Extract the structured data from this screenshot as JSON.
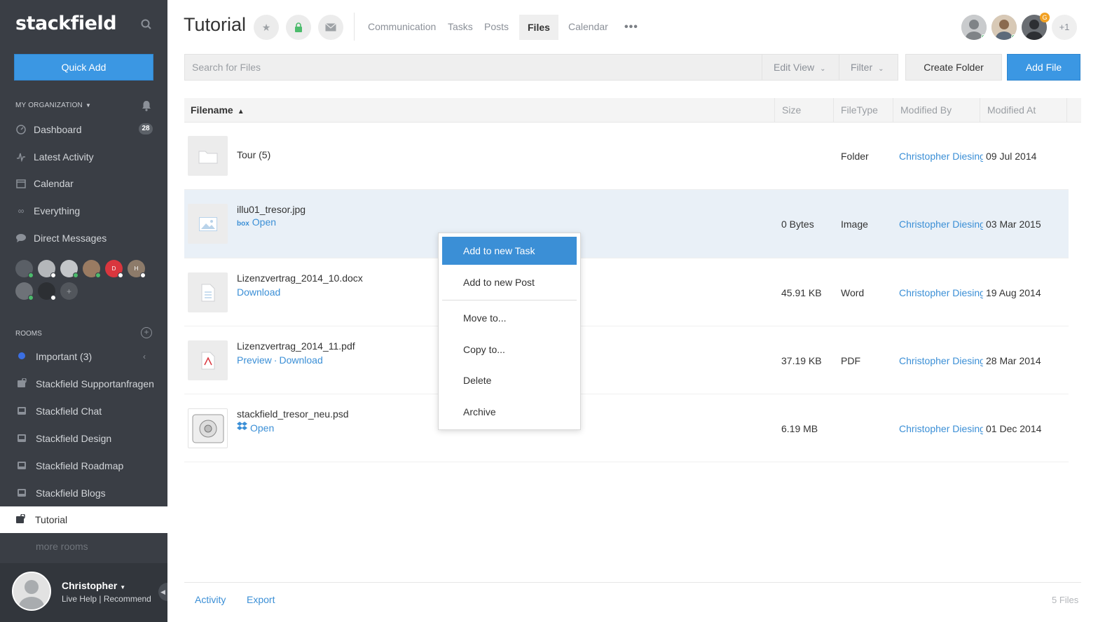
{
  "sidebar": {
    "logo": "stackfield",
    "quick_add": "Quick Add",
    "org_label": "MY ORGANIZATION",
    "nav": [
      {
        "label": "Dashboard",
        "icon": "dashboard-icon",
        "badge": "28"
      },
      {
        "label": "Latest Activity",
        "icon": "activity-icon"
      },
      {
        "label": "Calendar",
        "icon": "calendar-icon"
      },
      {
        "label": "Everything",
        "icon": "infinity-icon"
      },
      {
        "label": "Direct Messages",
        "icon": "chat-bubble-icon"
      }
    ],
    "member_avatars": [
      {
        "initial": "",
        "status": "online"
      },
      {
        "initial": "",
        "status": "offline"
      },
      {
        "initial": "",
        "status": "online"
      },
      {
        "initial": "",
        "status": "online"
      },
      {
        "initial": "D",
        "status": "offline",
        "color": "#d9363e"
      },
      {
        "initial": "H",
        "status": "offline",
        "color": "#8d7b6a"
      },
      {
        "initial": "",
        "status": "online"
      },
      {
        "initial": "",
        "status": "offline"
      },
      {
        "initial": "+",
        "status": ""
      }
    ],
    "rooms_label": "ROOMS",
    "rooms": [
      {
        "label": "Important (3)",
        "icon": "blue-dot-icon"
      },
      {
        "label": "Stackfield Supportanfragen",
        "icon": "room-lock-icon"
      },
      {
        "label": "Stackfield Chat",
        "icon": "room-icon"
      },
      {
        "label": "Stackfield Design",
        "icon": "room-icon"
      },
      {
        "label": "Stackfield Roadmap",
        "icon": "room-icon"
      },
      {
        "label": "Stackfield Blogs",
        "icon": "room-icon"
      }
    ],
    "active_room": "Tutorial",
    "more_rooms": "more rooms",
    "profile": {
      "name": "Christopher",
      "links": "Live Help | Recommend"
    }
  },
  "header": {
    "title": "Tutorial",
    "tabs": [
      "Communication",
      "Tasks",
      "Posts",
      "Files",
      "Calendar"
    ],
    "active_tab": "Files",
    "extra_members": "+1",
    "member_badge": "G"
  },
  "toolbar": {
    "search_placeholder": "Search for Files",
    "edit_view": "Edit View",
    "filter": "Filter",
    "create_folder": "Create Folder",
    "add_file": "Add File"
  },
  "table": {
    "columns": [
      "Filename",
      "Size",
      "FileType",
      "Modified By",
      "Modified At"
    ],
    "rows": [
      {
        "name": "Tour (5)",
        "links": [],
        "size": "",
        "type": "Folder",
        "by": "Christopher Diesing",
        "at": "09 Jul 2014",
        "thumb": "folder-icon"
      },
      {
        "name": "illu01_tresor.jpg",
        "links": [
          "Open"
        ],
        "size": "0 Bytes",
        "type": "Image",
        "by": "Christopher Diesing",
        "at": "03 Mar 2015",
        "thumb": "image-icon",
        "source": "box"
      },
      {
        "name": "Lizenzvertrag_2014_10.docx",
        "links": [
          "Download"
        ],
        "size": "45.91 KB",
        "type": "Word",
        "by": "Christopher Diesing",
        "at": "19 Aug 2014",
        "thumb": "document-icon"
      },
      {
        "name": "Lizenzvertrag_2014_11.pdf",
        "links": [
          "Preview",
          "Download"
        ],
        "size": "37.19 KB",
        "type": "PDF",
        "by": "Christopher Diesing",
        "at": "28 Mar 2014",
        "thumb": "pdf-icon"
      },
      {
        "name": "stackfield_tresor_neu.psd",
        "links": [
          "Open"
        ],
        "size": "6.19 MB",
        "type": "",
        "by": "Christopher Diesing",
        "at": "01 Dec 2014",
        "thumb": "safe-image-icon",
        "source": "dropbox"
      }
    ]
  },
  "context_menu": [
    "Add to new Task",
    "Add to new Post",
    "Move to...",
    "Copy to...",
    "Delete",
    "Archive"
  ],
  "footer": {
    "activity": "Activity",
    "export": "Export",
    "count": "5 Files"
  },
  "colors": {
    "accent": "#3b97e3",
    "sidebar_bg": "#3a3e45",
    "link": "#3b8fd6",
    "selected_row": "#e9f0f7"
  }
}
